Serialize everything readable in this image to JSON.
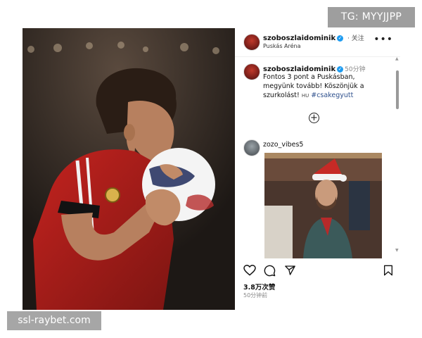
{
  "watermarks": {
    "top": "TG: MYYJJPP",
    "bottom": "ssl-raybet.com"
  },
  "post": {
    "header": {
      "username": "szoboszlaidominik",
      "follow_label": "关注",
      "location": "Puskás Aréna",
      "more_icon": "more-dots-icon"
    },
    "caption": {
      "username": "szoboszlaidominik",
      "time": "50分钟",
      "line1": "Fontos 3 pont a Puskásban,",
      "line2": "megyünk tovább! Köszönjük a",
      "line3": "szurkolást!",
      "flag_tag": "HU",
      "hashtag": "#csakegyutt"
    },
    "load_more_icon": "plus-circle-icon",
    "comment": {
      "username": "zozo_vibes5"
    },
    "actions": [
      "heart-icon",
      "comment-icon",
      "share-icon",
      "bookmark-icon"
    ],
    "likes": "3.8万次赞",
    "posted_ago": "50分钟前"
  }
}
